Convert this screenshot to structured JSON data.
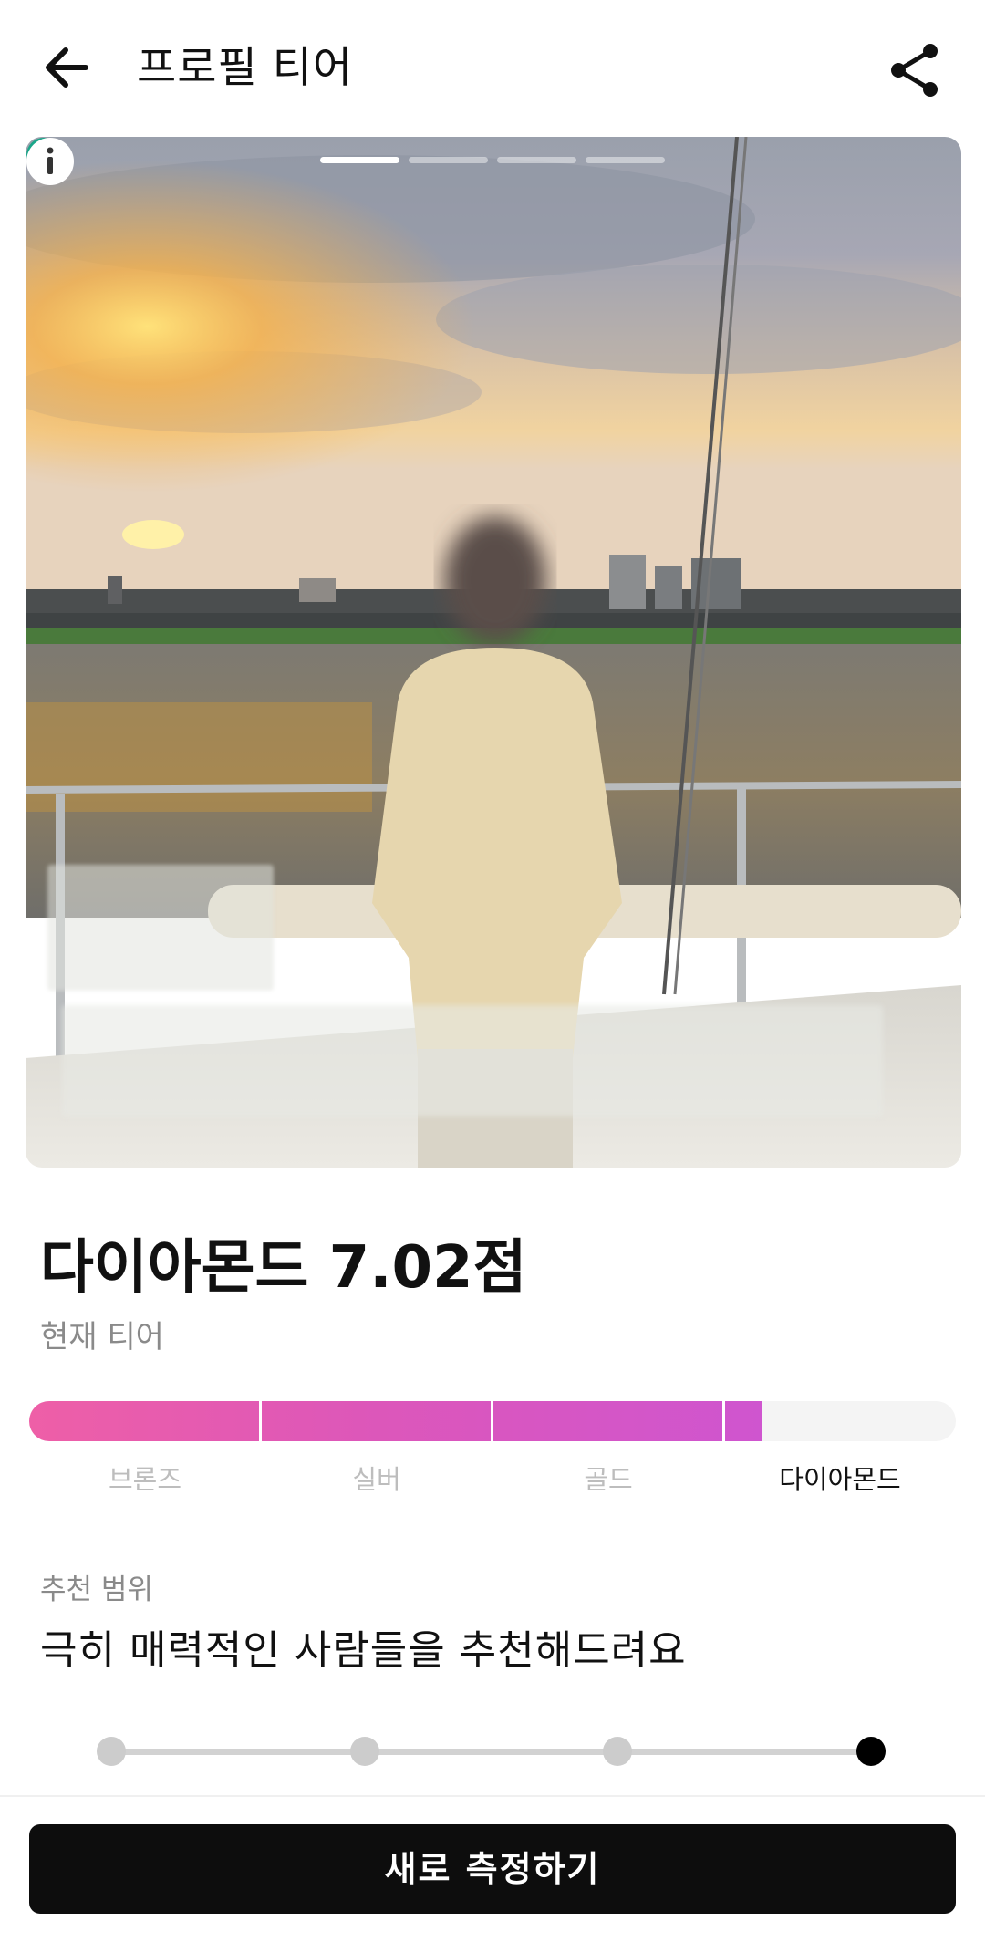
{
  "header": {
    "title": "프로필 티어",
    "back_icon": "arrow-left-icon",
    "share_icon": "share-icon"
  },
  "photo": {
    "total_photos": 4,
    "current_photo": 1,
    "verified_icon": "verified-check-icon",
    "info_icon": "info-icon",
    "accent_color": "#1aa689"
  },
  "score": {
    "title": "다이아몬드 7.02점",
    "subtitle": "현재 티어"
  },
  "tier_bar": {
    "fill_fraction": 0.79,
    "colors": [
      "#ee5fa7",
      "#cf55cf"
    ],
    "tiers": [
      {
        "label": "브론즈"
      },
      {
        "label": "실버"
      },
      {
        "label": "골드"
      },
      {
        "label": "다이아몬드"
      }
    ],
    "current_tier_index": 3
  },
  "recommendation": {
    "heading": "추천 범위",
    "text": "극히 매력적인 사람들을 추천해드려요",
    "steps": 4,
    "selected_step": 4
  },
  "action": {
    "label": "새로 측정하기"
  }
}
